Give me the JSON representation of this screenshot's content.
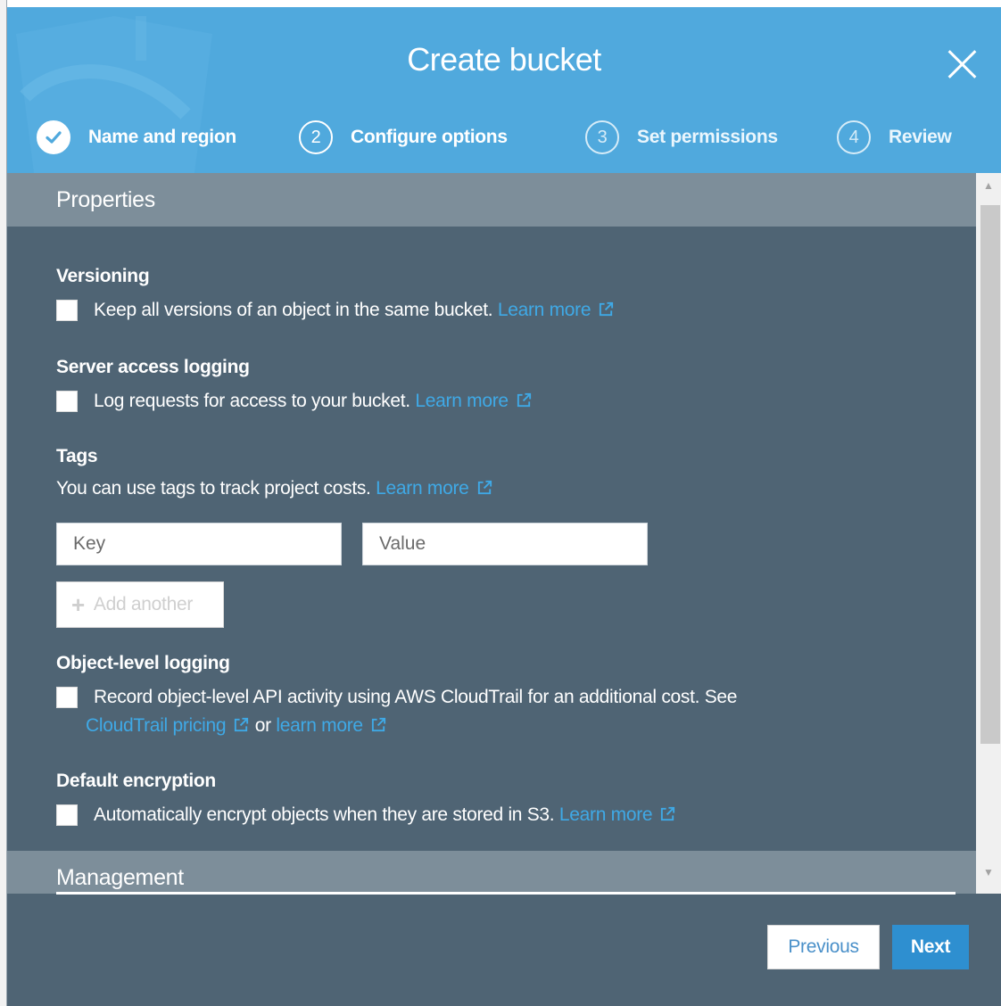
{
  "dialog": {
    "title": "Create bucket",
    "close_icon": "close-icon"
  },
  "steps": [
    {
      "number": "✓",
      "label": "Name and region",
      "state": "done"
    },
    {
      "number": "2",
      "label": "Configure options",
      "state": "current"
    },
    {
      "number": "3",
      "label": "Set permissions",
      "state": "future"
    },
    {
      "number": "4",
      "label": "Review",
      "state": "future"
    }
  ],
  "sections": {
    "properties": "Properties",
    "management": "Management"
  },
  "versioning": {
    "title": "Versioning",
    "text": "Keep all versions of an object in the same bucket.",
    "link": "Learn more"
  },
  "logging": {
    "title": "Server access logging",
    "text": "Log requests for access to your bucket.",
    "link": "Learn more"
  },
  "tags": {
    "title": "Tags",
    "text": "You can use tags to track project costs.",
    "link": "Learn more",
    "key_placeholder": "Key",
    "value_placeholder": "Value",
    "add_label": "Add another"
  },
  "object_logging": {
    "title": "Object-level logging",
    "text": "Record object-level API activity using AWS CloudTrail for an additional cost. See",
    "pricing_link": "CloudTrail pricing",
    "or": "or",
    "learn_link": "learn more"
  },
  "encryption": {
    "title": "Default encryption",
    "text": "Automatically encrypt objects when they are stored in S3.",
    "link": "Learn more"
  },
  "footer": {
    "previous_label": "Previous",
    "next_label": "Next"
  },
  "colors": {
    "header": "#50a9dd",
    "body": "#4f6474",
    "section_header": "#7d8e9a",
    "link": "#3fa9e6",
    "primary_button": "#2e8fd0"
  }
}
